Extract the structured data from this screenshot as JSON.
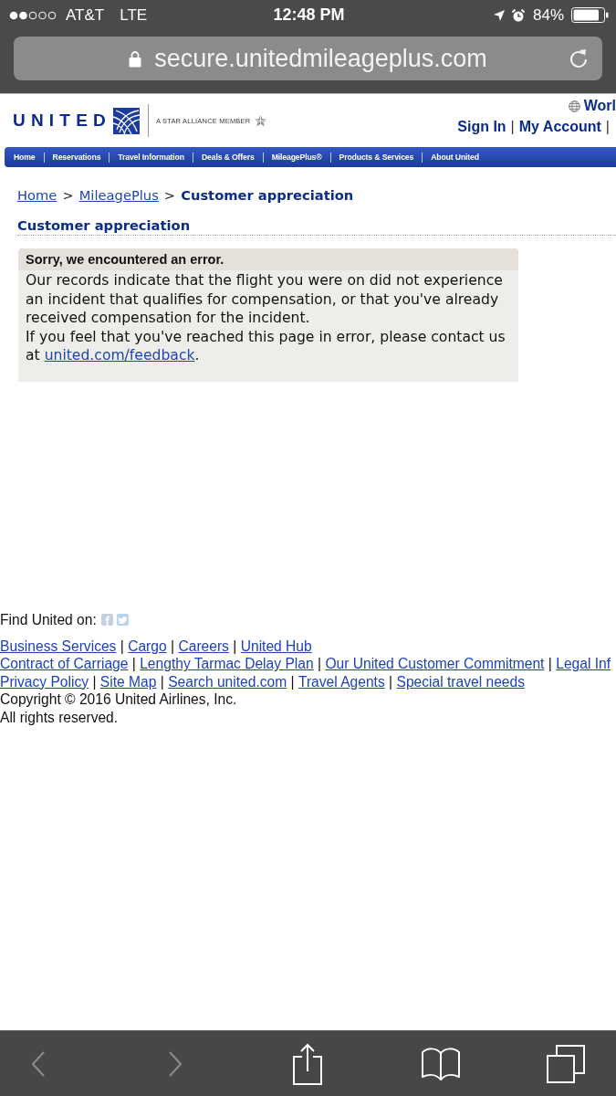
{
  "status_bar": {
    "carrier": "AT&T",
    "network": "LTE",
    "time": "12:48 PM",
    "battery": "84%"
  },
  "address_bar": {
    "url": "secure.unitedmileageplus.com"
  },
  "site_header": {
    "logo": "UNITED",
    "alliance": "A STAR ALLIANCE MEMBER",
    "language": "Worl",
    "account_links": [
      {
        "kind": "link",
        "text": "Sign In"
      },
      {
        "kind": "separator",
        "text": "|"
      },
      {
        "kind": "link",
        "text": "My Account"
      },
      {
        "kind": "separator",
        "text": "|"
      }
    ]
  },
  "nav": {
    "items": [
      "Home",
      "Reservations",
      "Travel Information",
      "Deals & Offers",
      "MileagePlus®",
      "Products & Services",
      "About United"
    ]
  },
  "breadcrumb": [
    {
      "kind": "link",
      "text": "Home"
    },
    {
      "kind": "separator",
      "text": ">"
    },
    {
      "kind": "link",
      "text": "MileagePlus"
    },
    {
      "kind": "separator",
      "text": ">"
    },
    {
      "kind": "current",
      "text": "Customer appreciation"
    }
  ],
  "page_title": "Customer appreciation",
  "error_box": {
    "title": "Sorry, we encountered an error.",
    "paragraphs": [
      {
        "text": "Our records indicate that the flight you were on did not experience an incident that qualifies for compensation, or that you've already received compensation for the incident."
      },
      {
        "text": "If you feel that you've reached this page in error, please contact us at ",
        "link": "united.com/feedback",
        "after": "."
      }
    ]
  },
  "footer": {
    "social_label": "Find United on:",
    "link_rows": [
      [
        {
          "kind": "link",
          "text": "Business Services"
        },
        {
          "kind": "separator",
          "text": "|"
        },
        {
          "kind": "link",
          "text": "Cargo"
        },
        {
          "kind": "separator",
          "text": "|"
        },
        {
          "kind": "link",
          "text": "Careers"
        },
        {
          "kind": "separator",
          "text": "|"
        },
        {
          "kind": "link",
          "text": "United Hub"
        }
      ],
      [
        {
          "kind": "link",
          "text": "Contract of Carriage"
        },
        {
          "kind": "separator",
          "text": "|"
        },
        {
          "kind": "link",
          "text": "Lengthy Tarmac Delay Plan"
        },
        {
          "kind": "separator",
          "text": "|"
        },
        {
          "kind": "link",
          "text": "Our United Customer Commitment"
        },
        {
          "kind": "separator",
          "text": "|"
        },
        {
          "kind": "link",
          "text": "Legal Inf"
        }
      ],
      [
        {
          "kind": "link",
          "text": "Privacy Policy"
        },
        {
          "kind": "separator",
          "text": "|"
        },
        {
          "kind": "link",
          "text": "Site Map"
        },
        {
          "kind": "separator",
          "text": "|"
        },
        {
          "kind": "link",
          "text": "Search united.com"
        },
        {
          "kind": "separator",
          "text": "|"
        },
        {
          "kind": "link",
          "text": "Travel Agents"
        },
        {
          "kind": "separator",
          "text": "|"
        },
        {
          "kind": "link",
          "text": "Special travel needs"
        }
      ]
    ],
    "copyright": [
      "Copyright © 2016 United Airlines, Inc.",
      "All rights reserved."
    ]
  },
  "toolbar": [
    {
      "kind": "back",
      "disabled": true
    },
    {
      "kind": "forward",
      "disabled": true
    },
    {
      "kind": "share",
      "disabled": false
    },
    {
      "kind": "bookmarks",
      "disabled": false
    },
    {
      "kind": "tabs",
      "disabled": false
    }
  ]
}
